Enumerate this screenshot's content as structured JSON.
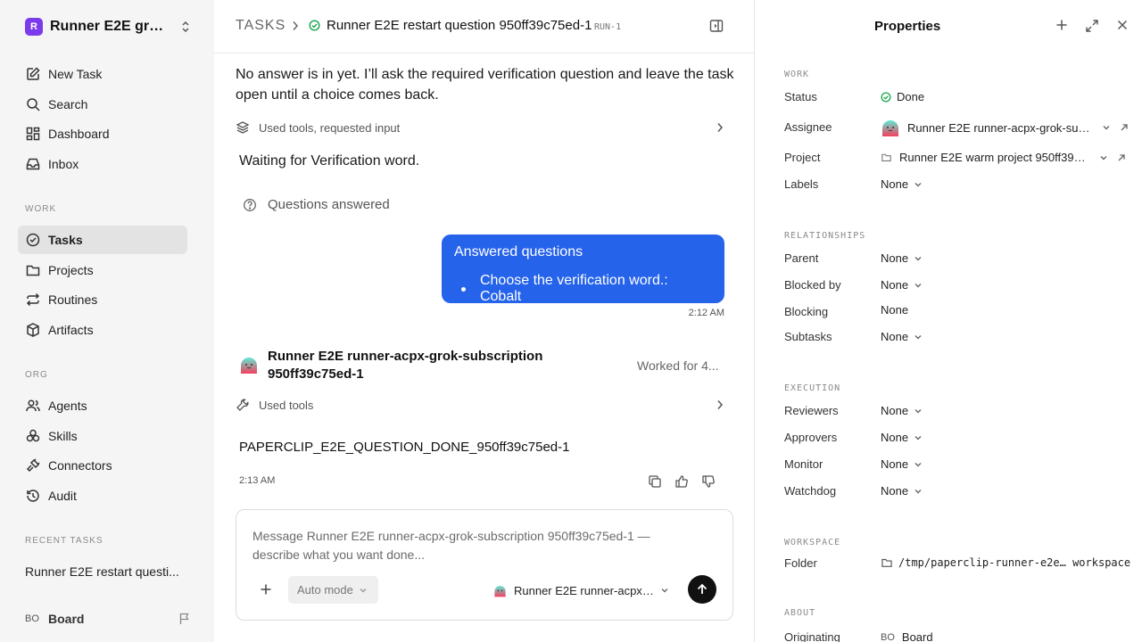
{
  "sidebar": {
    "workspace_logo": "R",
    "workspace_name": "Runner E2E grok-...",
    "nav_top": [
      {
        "label": "New Task",
        "icon": "edit-icon"
      },
      {
        "label": "Search",
        "icon": "search-icon"
      },
      {
        "label": "Dashboard",
        "icon": "dashboard-icon"
      },
      {
        "label": "Inbox",
        "icon": "inbox-icon"
      }
    ],
    "section_work": "WORK",
    "nav_work": [
      {
        "label": "Tasks",
        "icon": "check-circle-icon",
        "active": true
      },
      {
        "label": "Projects",
        "icon": "folder-icon"
      },
      {
        "label": "Routines",
        "icon": "repeat-icon"
      },
      {
        "label": "Artifacts",
        "icon": "box-icon"
      }
    ],
    "section_org": "ORG",
    "nav_org": [
      {
        "label": "Agents",
        "icon": "users-icon"
      },
      {
        "label": "Skills",
        "icon": "skills-icon"
      },
      {
        "label": "Connectors",
        "icon": "plug-icon"
      },
      {
        "label": "Audit",
        "icon": "history-icon"
      }
    ],
    "section_recent": "RECENT TASKS",
    "recent_task": "Runner E2E restart questi...",
    "board_initials": "BO",
    "board_label": "Board"
  },
  "header": {
    "breadcrumb_root": "TASKS",
    "task_title": "Runner E2E restart question 950ff39c75ed-1",
    "run_tag": "RUN-1"
  },
  "thread": {
    "intro_text": "No answer is in yet. I’ll ask the required verification question and leave the task open until a choice comes back.",
    "tool_row_1": "Used tools, requested input",
    "waiting_text": "Waiting for Verification word.",
    "questions_answered": "Questions answered",
    "bubble_title": "Answered questions",
    "bubble_item": "Choose the verification word.: Cobalt",
    "bubble_time": "2:12 AM",
    "agent_name": "Runner E2E runner-acpx-grok-subscription 950ff39c75ed-1",
    "worked_for": "Worked for 4...",
    "tool_row_2": "Used tools",
    "result_text": "PAPERCLIP_E2E_QUESTION_DONE_950ff39c75ed-1",
    "result_time": "2:13 AM"
  },
  "composer": {
    "placeholder": "Message Runner E2E runner-acpx-grok-subscription 950ff39c75ed-1 — describe what you want done...",
    "mode": "Auto mode",
    "agent": "Runner E2E runner-acpx-..."
  },
  "properties": {
    "title": "Properties",
    "work_heading": "WORK",
    "status_label": "Status",
    "status_value": "Done",
    "status_color": "#16a34a",
    "assignee_label": "Assignee",
    "assignee_value": "Runner E2E runner-acpx-grok-sub...",
    "project_label": "Project",
    "project_value": "Runner E2E warm project 950ff39c...",
    "labels_label": "Labels",
    "labels_value": "None",
    "relationships_heading": "RELATIONSHIPS",
    "parent_label": "Parent",
    "parent_value": "None",
    "blocked_by_label": "Blocked by",
    "blocked_by_value": "None",
    "blocking_label": "Blocking",
    "blocking_value": "None",
    "subtasks_label": "Subtasks",
    "subtasks_value": "None",
    "execution_heading": "EXECUTION",
    "reviewers_label": "Reviewers",
    "reviewers_value": "None",
    "approvers_label": "Approvers",
    "approvers_value": "None",
    "monitor_label": "Monitor",
    "monitor_value": "None",
    "watchdog_label": "Watchdog",
    "watchdog_value": "None",
    "workspace_heading": "WORKSPACE",
    "folder_label": "Folder",
    "folder_value": "/tmp/paperclip-runner-e2e… workspace",
    "about_heading": "ABOUT",
    "originating_label": "Originating",
    "originating_initials": "BO",
    "originating_value": "Board"
  },
  "colors": {
    "accent_blue": "#2563eb",
    "workspace_purple": "#7c3aed",
    "done_green": "#16a34a"
  }
}
